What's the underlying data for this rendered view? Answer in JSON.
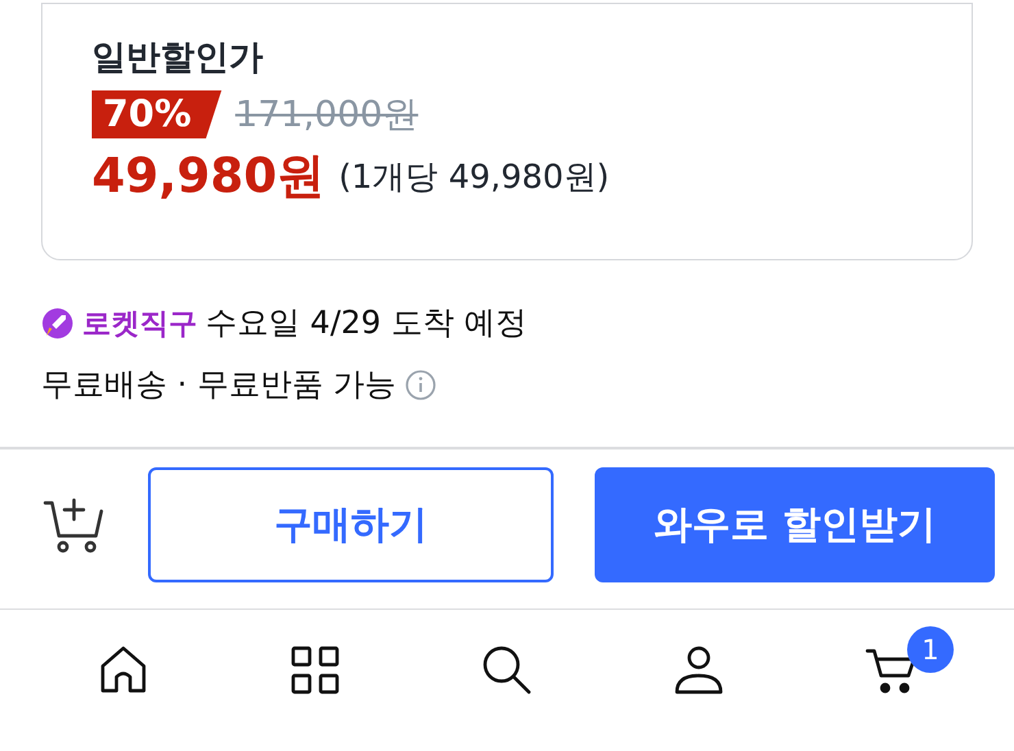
{
  "price_card": {
    "label": "일반할인가",
    "discount": "70%",
    "original_price": "171,000원",
    "sale_price": "49,980원",
    "unit_price": "(1개당 49,980원)"
  },
  "delivery": {
    "badge": "로켓직구",
    "arrival": "수요일 4/29 도착 예정",
    "shipping": "무료배송 · 무료반품 가능"
  },
  "actions": {
    "buy": "구매하기",
    "wow": "와우로 할인받기"
  },
  "nav": {
    "cart_badge": "1"
  }
}
